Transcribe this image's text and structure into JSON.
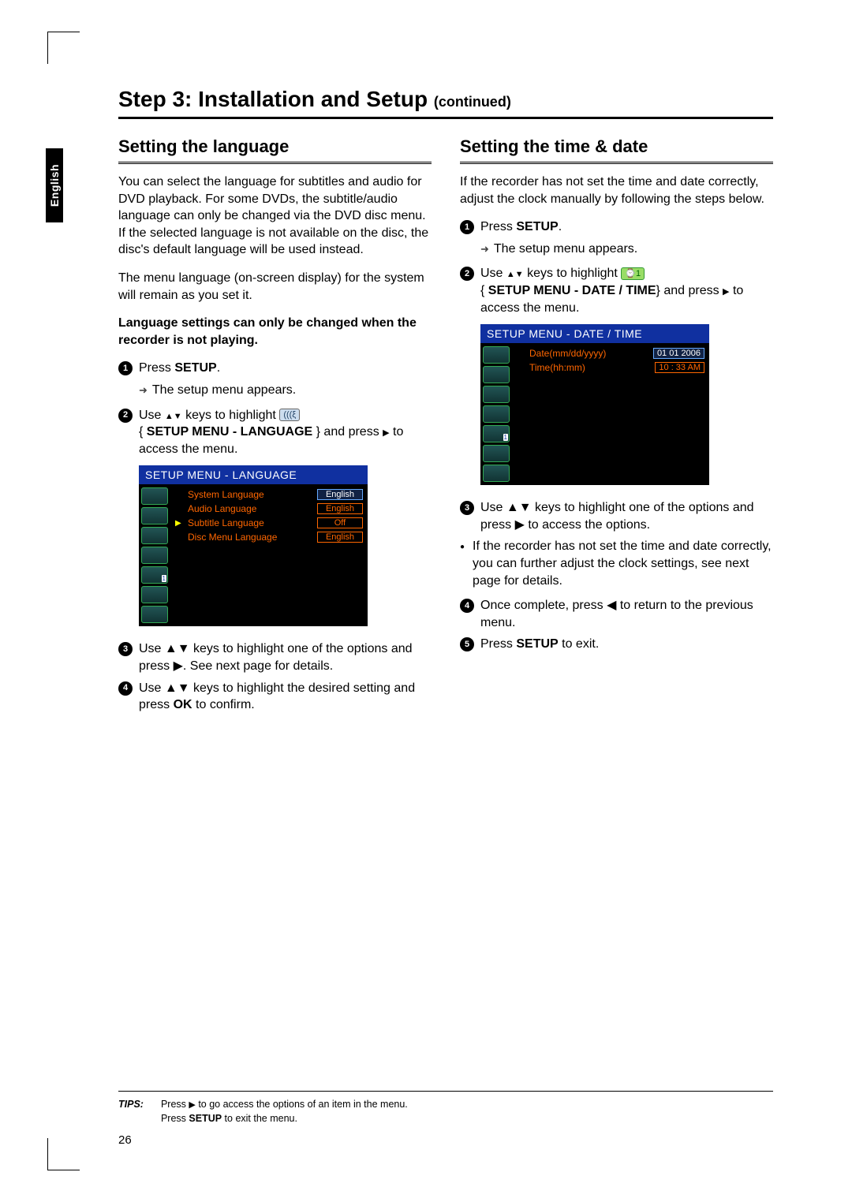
{
  "page_number": "26",
  "language_tab": "English",
  "title": {
    "main": "Step 3: Installation and Setup ",
    "suffix": "(continued)"
  },
  "left": {
    "heading": "Setting the language",
    "intro1": "You can select the language for subtitles and audio for DVD playback. For some DVDs, the subtitle/audio language can only be changed via the DVD disc menu. If the selected language is not available on the disc, the disc's default language will be used instead.",
    "intro2": "The menu language (on-screen display) for the system will remain as you set it.",
    "note": "Language settings can only be changed when the recorder is not playing.",
    "steps": {
      "s1a": "Press ",
      "s1b": "SETUP",
      "s1c": ".",
      "s1_sub": "The setup menu appears.",
      "s2a": "Use ",
      "s2b": " keys to highlight ",
      "s2c_label": "SETUP MENU - LANGUAGE",
      "s2d": " } and press ",
      "s2e": " to access the menu.",
      "s3": "Use ▲▼ keys to highlight one of the options and press ▶. See next page for details.",
      "s4a": "Use ▲▼ keys to highlight the desired setting and press ",
      "s4b": "OK",
      "s4c": " to confirm."
    },
    "osd": {
      "title": "SETUP MENU - LANGUAGE",
      "rows": [
        {
          "label": "System Language",
          "value": "English",
          "selected": true,
          "cursor": false
        },
        {
          "label": "Audio Language",
          "value": "English",
          "selected": false,
          "cursor": false
        },
        {
          "label": "Subtitle Language",
          "value": "Off",
          "selected": false,
          "cursor": true
        },
        {
          "label": "Disc Menu Language",
          "value": "English",
          "selected": false,
          "cursor": false
        }
      ]
    }
  },
  "right": {
    "heading": "Setting the time & date",
    "intro": "If the recorder has not set the time and date correctly, adjust the clock manually by following the steps below.",
    "steps": {
      "s1a": "Press ",
      "s1b": "SETUP",
      "s1c": ".",
      "s1_sub": "The setup menu appears.",
      "s2a": "Use ",
      "s2b": " keys to highlight ",
      "s2c_label": "SETUP MENU - DATE / TIME",
      "s2d": "} and press ",
      "s2e": " to access the menu.",
      "s3": "Use ▲▼ keys to highlight one of the options and press ▶ to access the options.",
      "bullet": "If the recorder has not set the time and date correctly, you can further adjust the clock settings, see next page for details.",
      "s4": "Once complete, press ◀ to return to the previous menu.",
      "s5a": "Press ",
      "s5b": "SETUP",
      "s5c": " to exit."
    },
    "osd": {
      "title": "SETUP MENU - DATE / TIME",
      "rows": [
        {
          "label": "Date(mm/dd/yyyy)",
          "value": "01  01 2006",
          "selected": true,
          "cursor": false
        },
        {
          "label": "Time(hh:mm)",
          "value": "10 : 33  AM",
          "selected": false,
          "cursor": false
        }
      ]
    }
  },
  "tips": {
    "label": "TIPS:",
    "line1a": "Press ",
    "line1b": " to go access the options of an item in the menu.",
    "line2a": "Press ",
    "line2b": "SETUP",
    "line2c": " to exit the menu."
  }
}
